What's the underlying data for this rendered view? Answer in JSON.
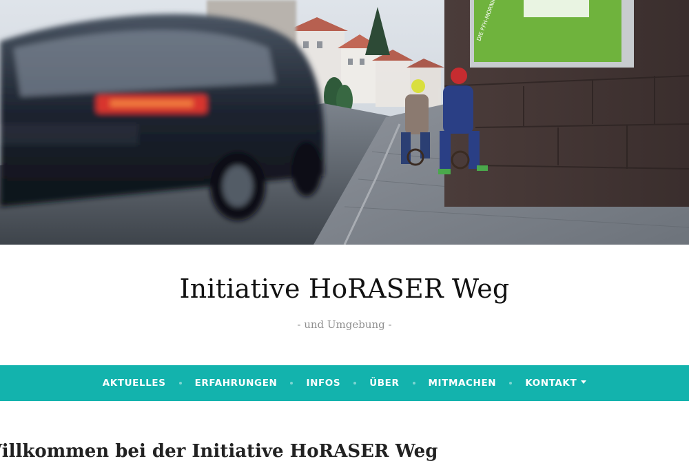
{
  "hero": {
    "billboard_text": "DIE FFH-MORNINGSHOW"
  },
  "site": {
    "title": "Initiative HoRASER Weg",
    "tagline": "- und Umgebung -"
  },
  "nav": {
    "items": [
      {
        "label": "AKTUELLES"
      },
      {
        "label": "ERFAHRUNGEN"
      },
      {
        "label": "INFOS"
      },
      {
        "label": "ÜBER"
      },
      {
        "label": "MITMACHEN"
      },
      {
        "label": "KONTAKT"
      }
    ],
    "bg_color": "#13b3ad"
  },
  "main": {
    "heading": "Willkommen bei der Initiative HoRASER Weg"
  }
}
